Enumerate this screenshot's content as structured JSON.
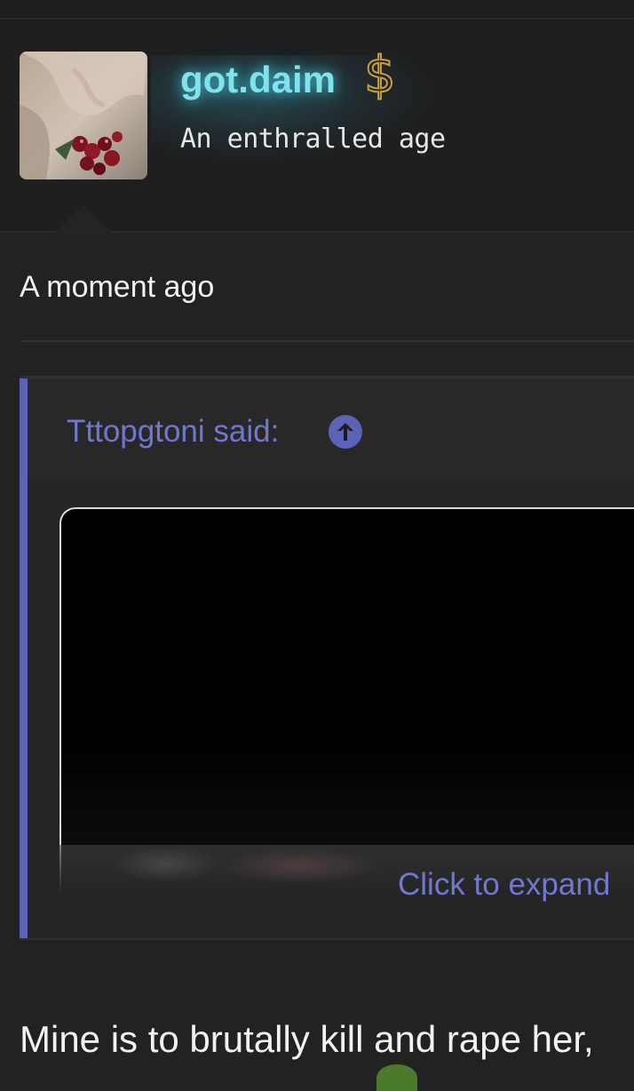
{
  "user": {
    "username": "got.daim",
    "title": "An enthralled age",
    "badge_icon": "dollar-icon",
    "username_color": "#7fe3ee",
    "badge_color": "#c9a13a"
  },
  "post": {
    "timestamp": "A moment ago",
    "quote": {
      "author_label": "Tttopgtoni said:",
      "jump_icon": "arrow-up-icon",
      "expand_label": "Click to expand",
      "accent_color": "#5b63b8"
    },
    "body_text": "Mine is to brutally kill and rape her,"
  }
}
